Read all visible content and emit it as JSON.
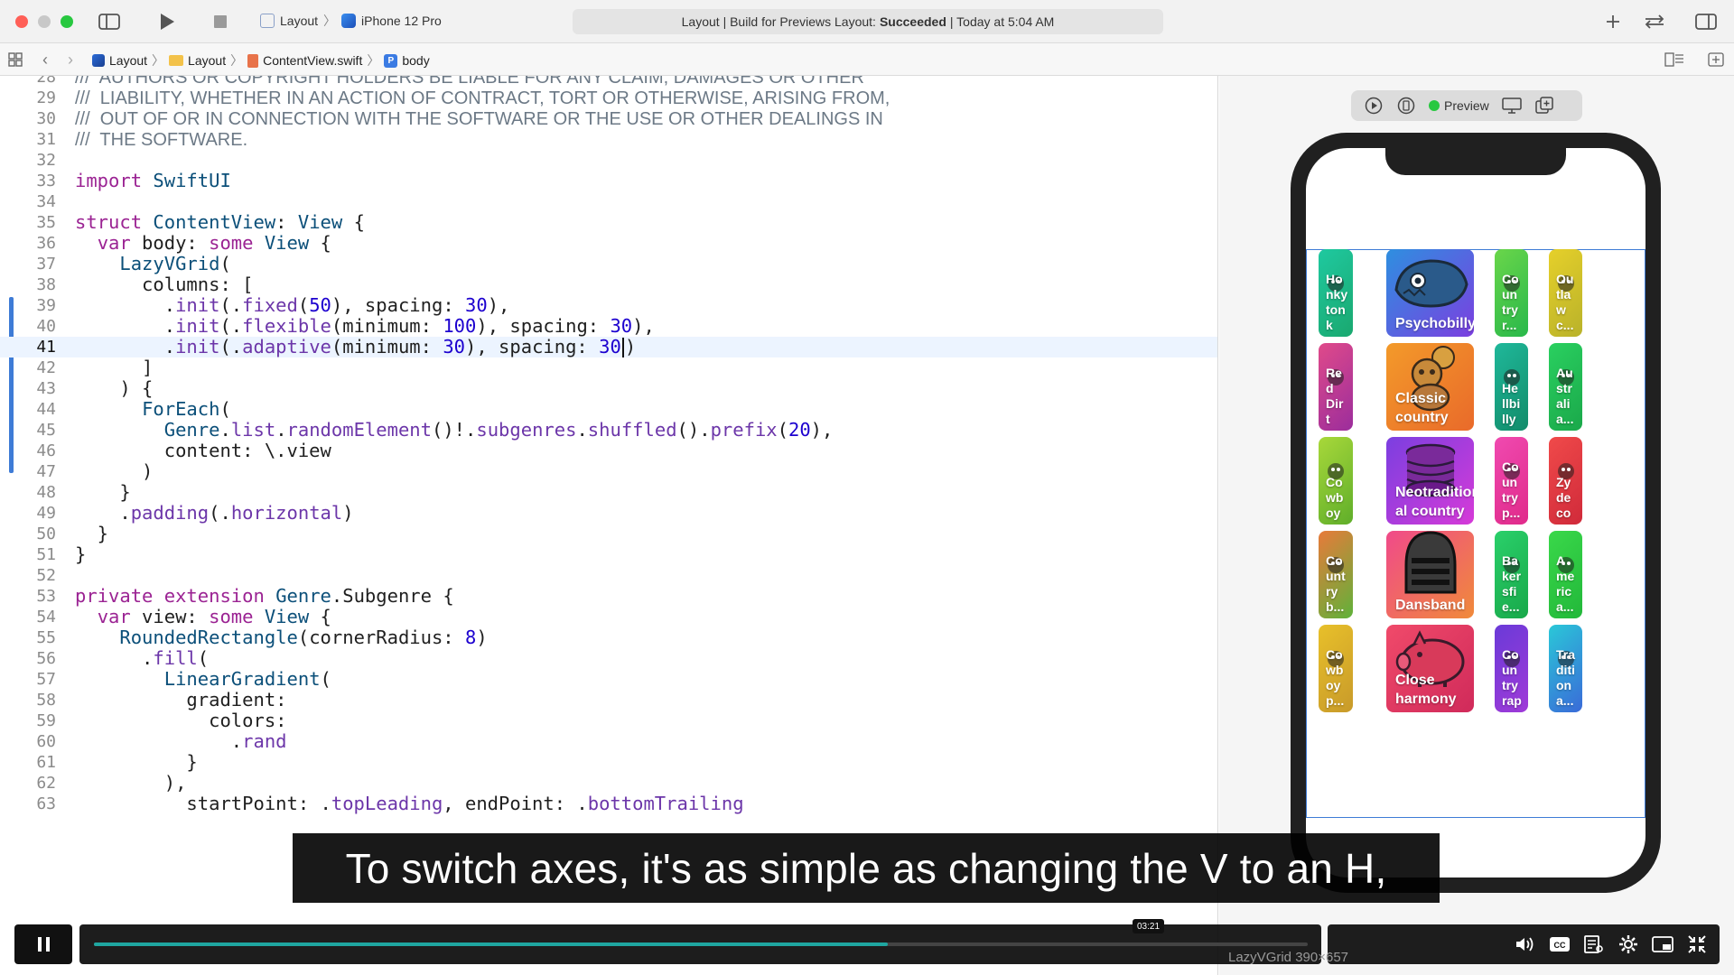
{
  "toolbar": {
    "scheme_project": "Layout",
    "scheme_device": "iPhone 12 Pro",
    "activity_prefix": "Layout | Build for Previews Layout:",
    "activity_status": "Succeeded",
    "activity_suffix": "| Today at 5:04 AM"
  },
  "jumpbar": {
    "crumbs": [
      "Layout",
      "Layout",
      "ContentView.swift",
      "body"
    ]
  },
  "editor": {
    "current_line": 41,
    "lines": [
      {
        "n": "28",
        "t": "///  AUTHORS OR COPYRIGHT HOLDERS BE LIABLE FOR ANY CLAIM, DAMAGES OR OTHER"
      },
      {
        "n": "29",
        "t": "///  LIABILITY, WHETHER IN AN ACTION OF CONTRACT, TORT OR OTHERWISE, ARISING FROM,"
      },
      {
        "n": "30",
        "t": "///  OUT OF OR IN CONNECTION WITH THE SOFTWARE OR THE USE OR OTHER DEALINGS IN"
      },
      {
        "n": "31",
        "t": "///  THE SOFTWARE."
      },
      {
        "n": "32",
        "t": ""
      },
      {
        "n": "33",
        "t": "import SwiftUI"
      },
      {
        "n": "34",
        "t": ""
      },
      {
        "n": "35",
        "t": "struct ContentView: View {"
      },
      {
        "n": "36",
        "t": "  var body: some View {"
      },
      {
        "n": "37",
        "t": "    LazyVGrid("
      },
      {
        "n": "38",
        "t": "      columns: ["
      },
      {
        "n": "39",
        "t": "        .init(.fixed(50), spacing: 30),"
      },
      {
        "n": "40",
        "t": "        .init(.flexible(minimum: 100), spacing: 30),"
      },
      {
        "n": "41",
        "t": "        .init(.adaptive(minimum: 30), spacing: 30)"
      },
      {
        "n": "42",
        "t": "      ]"
      },
      {
        "n": "43",
        "t": "    ) {"
      },
      {
        "n": "44",
        "t": "      ForEach("
      },
      {
        "n": "45",
        "t": "        Genre.list.randomElement()!.subgenres.shuffled().prefix(20),"
      },
      {
        "n": "46",
        "t": "        content: \\.view"
      },
      {
        "n": "47",
        "t": "      )"
      },
      {
        "n": "48",
        "t": "    }"
      },
      {
        "n": "49",
        "t": "    .padding(.horizontal)"
      },
      {
        "n": "50",
        "t": "  }"
      },
      {
        "n": "51",
        "t": "}"
      },
      {
        "n": "52",
        "t": ""
      },
      {
        "n": "53",
        "t": "private extension Genre.Subgenre {"
      },
      {
        "n": "54",
        "t": "  var view: some View {"
      },
      {
        "n": "55",
        "t": "    RoundedRectangle(cornerRadius: 8)"
      },
      {
        "n": "56",
        "t": "      .fill("
      },
      {
        "n": "57",
        "t": "        LinearGradient("
      },
      {
        "n": "58",
        "t": "          gradient:"
      },
      {
        "n": "59",
        "t": "            colors:"
      },
      {
        "n": "60",
        "t": "              .rand"
      },
      {
        "n": "61",
        "t": "          }"
      },
      {
        "n": "62",
        "t": "        ),"
      },
      {
        "n": "63",
        "t": "          startPoint: .topLeading, endPoint: .bottomTrailing"
      }
    ]
  },
  "preview": {
    "label": "Preview",
    "tiles": [
      {
        "label": "Ho\nnky\nton\nk",
        "c1": "#1fc9a0",
        "c2": "#1aa86f",
        "col": 0,
        "row": 0,
        "icon": "critter-icon"
      },
      {
        "label": "Psychobilly",
        "c1": "#2e8fe0",
        "c2": "#7b3fe0",
        "col": 1,
        "row": 0,
        "icon": "fish-icon"
      },
      {
        "label": "Co\nun\ntry\nr...",
        "c1": "#6ad64a",
        "c2": "#28b84a",
        "col": 2,
        "row": 0,
        "icon": "critter-icon"
      },
      {
        "label": "Ou\ntla\nw\nc...",
        "c1": "#e6d02a",
        "c2": "#b9b22a",
        "col": 3,
        "row": 0,
        "icon": "critter-icon"
      },
      {
        "label": "Re\nd\nDir\nt",
        "c1": "#e04a8a",
        "c2": "#9b2d9c",
        "col": 0,
        "row": 1,
        "icon": "critter-icon"
      },
      {
        "label": "Classic\ncountry",
        "c1": "#f39a2a",
        "c2": "#e96a2a",
        "col": 1,
        "row": 1,
        "icon": "bear-icon"
      },
      {
        "label": "He\nllbi\nlly",
        "c1": "#1fb89a",
        "c2": "#128c6a",
        "col": 2,
        "row": 1,
        "icon": "critter-icon"
      },
      {
        "label": "Au\nstr\nali\na...",
        "c1": "#2ad060",
        "c2": "#1aa84a",
        "col": 3,
        "row": 1,
        "icon": "critter-icon"
      },
      {
        "label": "Co\nwb\noy",
        "c1": "#a8d83a",
        "c2": "#5fae2a",
        "col": 0,
        "row": 2,
        "icon": "critter-icon"
      },
      {
        "label": "Neotradition\nal country",
        "c1": "#7b3fe0",
        "c2": "#d63ad8",
        "col": 1,
        "row": 2,
        "icon": "pancakes-icon"
      },
      {
        "label": "Co\nun\ntry\np...",
        "c1": "#f04ab0",
        "c2": "#e02a8a",
        "col": 2,
        "row": 2,
        "icon": "critter-icon"
      },
      {
        "label": "Zy\nde\nco",
        "c1": "#f04a4a",
        "c2": "#d02a3a",
        "col": 3,
        "row": 2,
        "icon": "critter-icon"
      },
      {
        "label": "Co\nunt\nry\nb...",
        "c1": "#e87a3a",
        "c2": "#5fb23a",
        "col": 0,
        "row": 3,
        "icon": "critter-icon"
      },
      {
        "label": "Dansband",
        "c1": "#f04a8a",
        "c2": "#f08a3a",
        "col": 1,
        "row": 3,
        "icon": "helmet-icon"
      },
      {
        "label": "Ba\nker\nsfi\ne...",
        "c1": "#2ad06a",
        "c2": "#18a84a",
        "col": 2,
        "row": 3,
        "icon": "critter-icon"
      },
      {
        "label": "A\nme\nric\na...",
        "c1": "#3ad84a",
        "c2": "#22b83a",
        "col": 3,
        "row": 3,
        "icon": "critter-icon"
      },
      {
        "label": "Co\nwb\noy\np...",
        "c1": "#e8c02a",
        "c2": "#c89a2a",
        "col": 0,
        "row": 4,
        "icon": "critter-icon"
      },
      {
        "label": "Close\nharmony",
        "c1": "#f04a6a",
        "c2": "#d02a5a",
        "col": 1,
        "row": 4,
        "icon": "pig-icon"
      },
      {
        "label": "Co\nun\ntry\nrap",
        "c1": "#6a3ad8",
        "c2": "#a03ad8",
        "col": 2,
        "row": 4,
        "icon": "critter-icon"
      },
      {
        "label": "Tra\nditi\non\na...",
        "c1": "#2ac8d8",
        "c2": "#3a6ad8",
        "col": 3,
        "row": 4,
        "icon": "critter-icon"
      }
    ]
  },
  "caption": "To switch axes, it's as simple as changing the V to an H,",
  "player": {
    "time": "03:21",
    "progress": 0.654
  },
  "status": {
    "selection": "LazyVGrid 390×657"
  }
}
